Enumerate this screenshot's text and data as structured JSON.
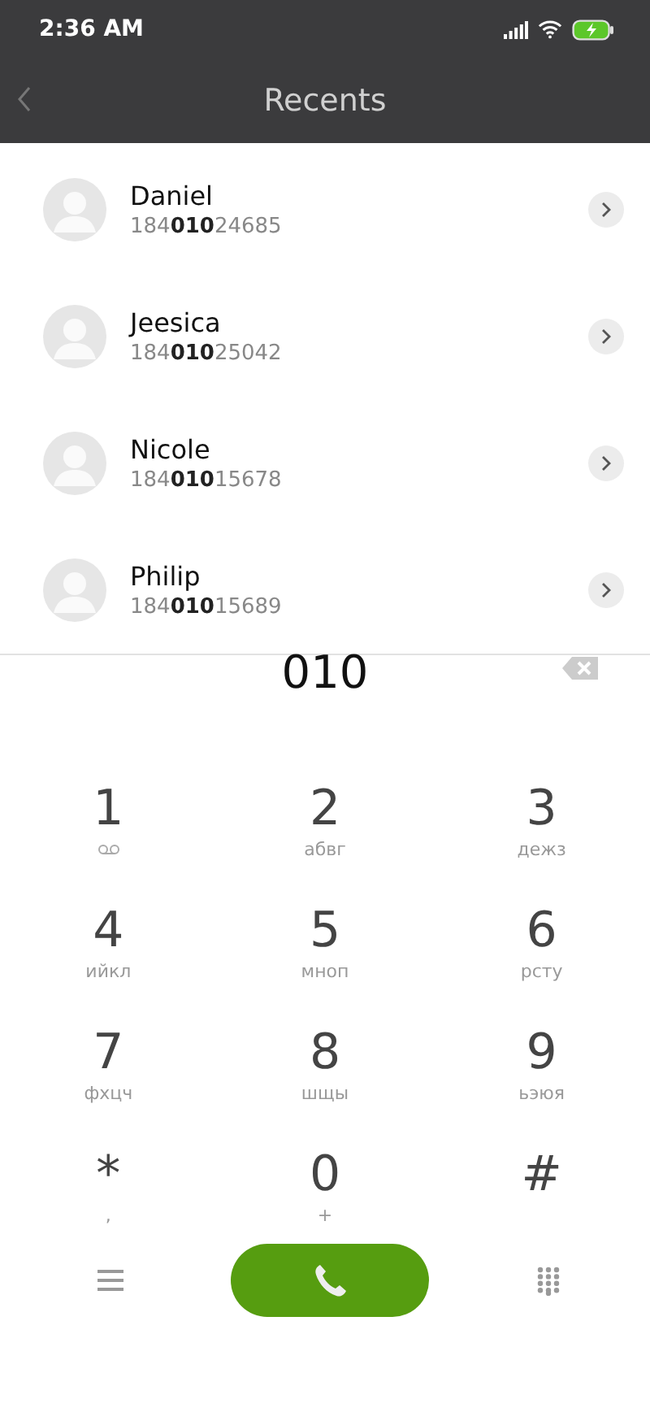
{
  "status_bar": {
    "time": "2:36 AM"
  },
  "header": {
    "title": "Recents"
  },
  "contacts": [
    {
      "name": "Daniel",
      "number": "184**010**24685"
    },
    {
      "name": "Jeesica",
      "number": "184**010**25042"
    },
    {
      "name": "Nicole",
      "number": "184**010**15678"
    },
    {
      "name": "Philip",
      "number": "184**010**15689"
    }
  ],
  "dialed": "010",
  "keys": [
    {
      "digit": "1",
      "kind": "voicemail"
    },
    {
      "digit": "2",
      "kind": "letters",
      "letters": "абвг"
    },
    {
      "digit": "3",
      "kind": "letters",
      "letters": "дежз"
    },
    {
      "digit": "4",
      "kind": "letters",
      "letters": "ийкл"
    },
    {
      "digit": "5",
      "kind": "letters",
      "letters": "мноп"
    },
    {
      "digit": "6",
      "kind": "letters",
      "letters": "рсту"
    },
    {
      "digit": "7",
      "kind": "letters",
      "letters": "фхцч"
    },
    {
      "digit": "8",
      "kind": "letters",
      "letters": "шщы"
    },
    {
      "digit": "9",
      "kind": "letters",
      "letters": "ьэюя"
    },
    {
      "digit": "*",
      "kind": "letters",
      "letters": ","
    },
    {
      "digit": "0",
      "kind": "letters",
      "letters": "+"
    },
    {
      "digit": "#",
      "kind": "plain"
    }
  ]
}
